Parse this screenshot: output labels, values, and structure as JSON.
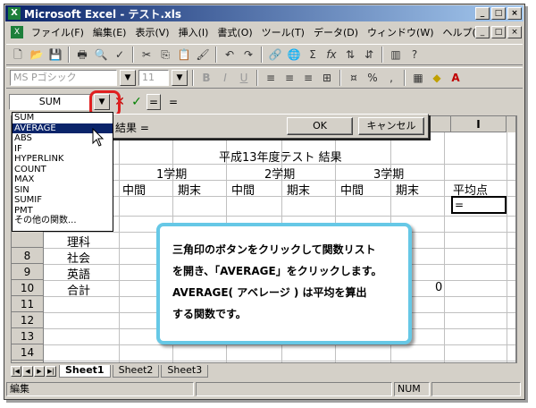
{
  "window": {
    "title": "Microsoft Excel - テスト.xls",
    "app_icon": "X"
  },
  "title_buttons": [
    "_",
    "□",
    "×"
  ],
  "doc_buttons": [
    "_",
    "□",
    "×"
  ],
  "menu": {
    "doc_icon": "X",
    "items": [
      "ファイル(F)",
      "編集(E)",
      "表示(V)",
      "挿入(I)",
      "書式(O)",
      "ツール(T)",
      "データ(D)",
      "ウィンドウ(W)",
      "ヘルプ(H)"
    ]
  },
  "toolbar_standard": {
    "icons": [
      "new-icon",
      "open-icon",
      "save-icon",
      "print-icon",
      "print-preview-icon",
      "spell-check-icon",
      "cut-icon",
      "copy-icon",
      "paste-icon",
      "format-painter-icon",
      "undo-icon",
      "redo-icon",
      "hyperlink-icon",
      "web-icon",
      "autosum-icon",
      "function-icon",
      "sort-asc-icon",
      "sort-desc-icon",
      "chart-icon",
      "help-icon"
    ],
    "glyphs": {
      "autosum": "Σ",
      "function": "fx"
    }
  },
  "toolbar_format": {
    "font_name": "MS Pゴシック",
    "font_size": "11",
    "bold": "B",
    "italic": "I",
    "underline": "U",
    "percent": "%",
    "comma": ","
  },
  "formula_bar": {
    "name_box": "SUM",
    "confirm_symbol": "=",
    "value": "="
  },
  "function_list": [
    "SUM",
    "AVERAGE",
    "ABS",
    "IF",
    "HYPERLINK",
    "COUNT",
    "MAX",
    "SIN",
    "SUMIF",
    "PMT",
    "その他の関数..."
  ],
  "function_list_selected": "AVERAGE",
  "function_dialog": {
    "label": "結果 =",
    "ok_label": "OK",
    "cancel_label": "キャンセル"
  },
  "sheet": {
    "column_header_visible": "I",
    "title": "平成13年度テスト 結果",
    "term1": "1学期",
    "term2": "2学期",
    "term3": "3学期",
    "mid": "中間",
    "final": "期末",
    "avg": "平均点",
    "selected_cell_value": "=",
    "row_labels": [
      "理科",
      "社会",
      "英語",
      "合計"
    ],
    "total_value": "0",
    "row_numbers": [
      "8",
      "9",
      "10",
      "11",
      "12",
      "13",
      "14",
      "15"
    ]
  },
  "sheet_tabs": [
    "Sheet1",
    "Sheet2",
    "Sheet3"
  ],
  "active_sheet": "Sheet1",
  "status": {
    "mode": "編集",
    "num": "NUM"
  },
  "callout": {
    "lines": [
      "三角印のボタンをクリックして関数リスト",
      "を開き、「AVERAGE」をクリックします。",
      "AVERAGE( アベレージ ) は平均を算出",
      "する関数です。"
    ]
  },
  "colors": {
    "title_bar": "#0a246a",
    "highlight_ring": "#e02020",
    "callout_border": "#66c8e6",
    "selection": "#0a246a"
  }
}
